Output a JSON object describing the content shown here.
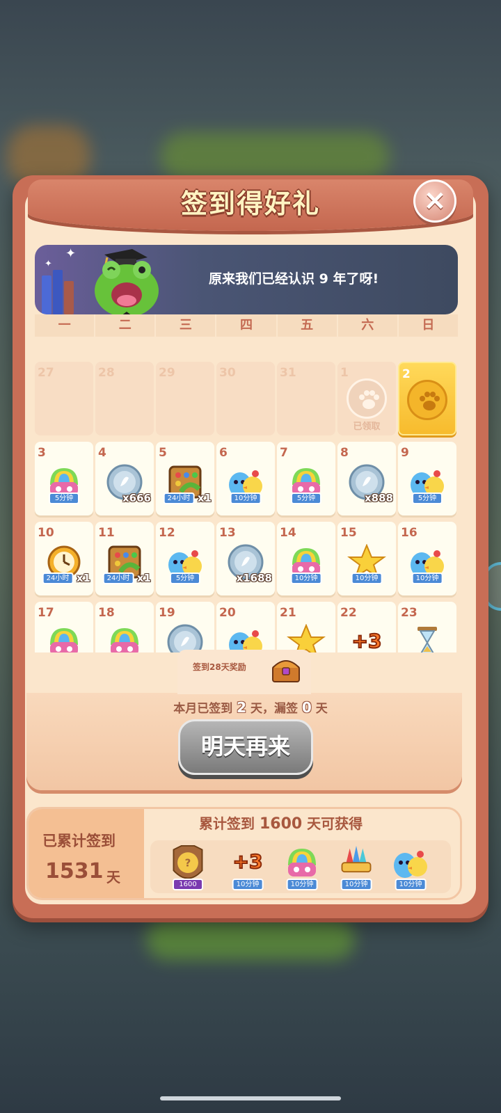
{
  "title": "签到得好礼",
  "close_icon": "×",
  "banner": {
    "text": "原来我们已经认识 9 年了呀!"
  },
  "weekdays": [
    "一",
    "二",
    "三",
    "四",
    "五",
    "六",
    "日"
  ],
  "calendar": {
    "claimed_label": "已领取",
    "cells": [
      {
        "day": "27",
        "state": "past"
      },
      {
        "day": "28",
        "state": "past"
      },
      {
        "day": "29",
        "state": "past"
      },
      {
        "day": "30",
        "state": "past"
      },
      {
        "day": "31",
        "state": "past"
      },
      {
        "day": "1",
        "state": "claimed"
      },
      {
        "day": "2",
        "state": "today"
      },
      {
        "day": "3",
        "reward": "rainbow-feather-icon",
        "tag": "5分钟"
      },
      {
        "day": "4",
        "reward": "silver-coin-icon",
        "qty": "x666"
      },
      {
        "day": "5",
        "reward": "game-box-icon",
        "tag": "24小时",
        "qty": "x1"
      },
      {
        "day": "6",
        "reward": "blue-monster-chick-icon",
        "tag": "10分钟"
      },
      {
        "day": "7",
        "reward": "rainbow-feather-icon",
        "tag": "5分钟"
      },
      {
        "day": "8",
        "reward": "silver-coin-icon",
        "qty": "x888"
      },
      {
        "day": "9",
        "reward": "blue-monster-chick-icon",
        "tag": "5分钟"
      },
      {
        "day": "10",
        "reward": "clock-icon",
        "tag": "24小时",
        "qty": "x1"
      },
      {
        "day": "11",
        "reward": "game-box-icon",
        "tag": "24小时",
        "qty": "x1"
      },
      {
        "day": "12",
        "reward": "blue-monster-chick-icon",
        "tag": "5分钟"
      },
      {
        "day": "13",
        "reward": "silver-coin-icon",
        "qty": "x1688"
      },
      {
        "day": "14",
        "reward": "rainbow-feather-icon",
        "tag": "10分钟"
      },
      {
        "day": "15",
        "reward": "score-star-icon",
        "tag": "10分钟"
      },
      {
        "day": "16",
        "reward": "blue-monster-chick-icon",
        "tag": "10分钟"
      },
      {
        "day": "17",
        "reward": "rainbow-feather-icon"
      },
      {
        "day": "18",
        "reward": "rainbow-feather-icon"
      },
      {
        "day": "19",
        "reward": "silver-coin-icon"
      },
      {
        "day": "20",
        "reward": "blue-monster-chick-icon"
      },
      {
        "day": "21",
        "reward": "score-star-icon"
      },
      {
        "day": "22",
        "reward": "plus-three-icon"
      },
      {
        "day": "23",
        "reward": "hourglass-icon"
      }
    ]
  },
  "reward_28": {
    "label": "签到28天奖励",
    "icon": "treasure-chest-icon"
  },
  "month_info": {
    "prefix": "本月已签到",
    "signed": "2",
    "mid": "天，漏签",
    "missed": "0",
    "suffix": "天"
  },
  "come_back_button": "明天再来",
  "cumulative": {
    "label": "已累计签到",
    "days": "1531",
    "unit": "天",
    "goal_prefix": "累计签到",
    "goal_days": "1600",
    "goal_suffix": "天可获得",
    "items": [
      {
        "icon": "badge-1600-icon",
        "tag": "1600"
      },
      {
        "icon": "plus-three-icon",
        "tag": "10分钟"
      },
      {
        "icon": "rainbow-feather-icon",
        "tag": "10分钟"
      },
      {
        "icon": "color-bombs-icon",
        "tag": "10分钟"
      },
      {
        "icon": "blue-monster-chick-icon",
        "tag": "10分钟"
      }
    ]
  },
  "colors": {
    "panel": "#c86e56",
    "cream": "#fbe6cc",
    "today": "#f7bb2d",
    "tag_blue": "#4b8ad6"
  }
}
